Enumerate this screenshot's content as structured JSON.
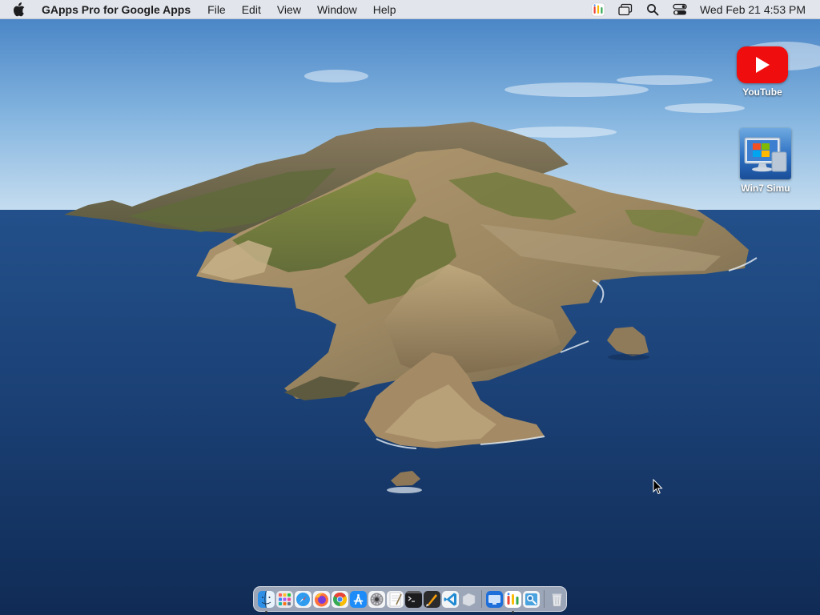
{
  "menubar": {
    "apple_icon": "apple-logo-icon",
    "app_name": "GApps Pro for Google Apps",
    "menus": [
      "File",
      "Edit",
      "View",
      "Window",
      "Help"
    ],
    "status_icons": [
      "gapps-icon",
      "screen-mirroring-icon",
      "spotlight-search-icon",
      "control-center-icon"
    ],
    "clock": "Wed Feb 21  4:53 PM"
  },
  "desktop": {
    "icons": [
      {
        "label": "YouTube",
        "icon": "youtube-icon"
      },
      {
        "label": "Win7 Simu",
        "icon": "win7-simulator-icon"
      }
    ]
  },
  "dock": {
    "apps": [
      {
        "icon": "finder-icon",
        "running": true
      },
      {
        "icon": "launchpad-icon",
        "running": false
      },
      {
        "icon": "safari-icon",
        "running": false
      },
      {
        "icon": "firefox-icon",
        "running": false
      },
      {
        "icon": "chrome-icon",
        "running": false
      },
      {
        "icon": "app-store-icon",
        "running": false
      },
      {
        "icon": "system-preferences-icon",
        "running": false
      },
      {
        "icon": "textedit-icon",
        "running": false
      },
      {
        "icon": "terminal-icon",
        "running": false
      },
      {
        "icon": "sublime-icon",
        "running": false
      },
      {
        "icon": "vscode-icon",
        "running": false
      },
      {
        "icon": "blank-app-icon",
        "running": false
      },
      {
        "icon": "remote-desktop-icon",
        "running": false
      },
      {
        "icon": "gapps-icon",
        "running": true
      },
      {
        "icon": "preview-icon",
        "running": false
      }
    ],
    "trash_icon": "trash-icon"
  },
  "colors": {
    "sky_top": "#4a86c6",
    "sea": "#1c3f72",
    "youtube_red": "#f00d0d",
    "menubar_bg": "#ececee"
  }
}
